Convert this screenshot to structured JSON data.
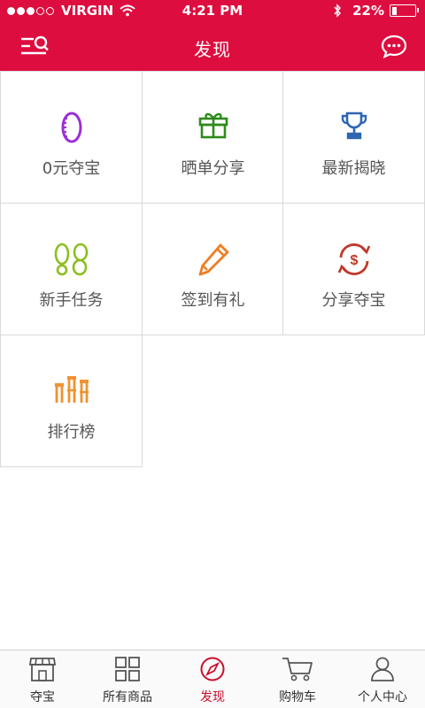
{
  "status_bar": {
    "carrier": "VIRGIN",
    "time": "4:21 PM",
    "battery": "22%",
    "battery_level": 0.22,
    "signal_full_dots": 3,
    "signal_total_dots": 5
  },
  "header": {
    "title": "发现",
    "left_icon": "search-menu-icon",
    "right_icon": "chat-bubble-icon",
    "color": "#de0d3f"
  },
  "grid": {
    "items": [
      {
        "label": "0元夺宝",
        "icon": "coin-icon",
        "color": "#9b2fd6"
      },
      {
        "label": "晒单分享",
        "icon": "gift-icon",
        "color": "#2f8a1c"
      },
      {
        "label": "最新揭晓",
        "icon": "trophy-icon",
        "color": "#2e67b1"
      },
      {
        "label": "新手任务",
        "icon": "footprints-icon",
        "color": "#8bbf1f"
      },
      {
        "label": "签到有礼",
        "icon": "pencil-icon",
        "color": "#ef7d22"
      },
      {
        "label": "分享夺宝",
        "icon": "dollar-exchange-icon",
        "color": "#c0392b"
      },
      {
        "label": "排行榜",
        "icon": "ranking-icon",
        "color": "#f0922f"
      }
    ]
  },
  "tabbar": {
    "active_index": 2,
    "active_color": "#c8102e",
    "items": [
      {
        "label": "夺宝",
        "icon": "store-icon"
      },
      {
        "label": "所有商品",
        "icon": "grid-icon"
      },
      {
        "label": "发现",
        "icon": "compass-icon"
      },
      {
        "label": "购物车",
        "icon": "cart-icon"
      },
      {
        "label": "个人中心",
        "icon": "person-icon"
      }
    ]
  }
}
